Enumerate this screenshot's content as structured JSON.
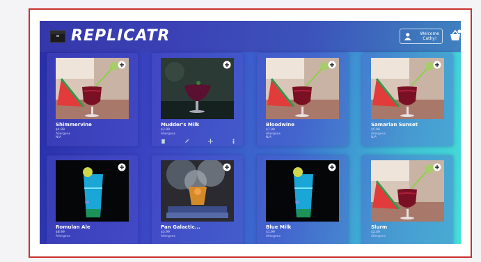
{
  "app": {
    "title": "REPLICATR",
    "welcome_label": "Welcome Cathy!"
  },
  "icons": {
    "logo": "chest-icon",
    "user": "user-icon",
    "cart": "basket-icon",
    "add": "plus-circle-icon"
  },
  "colors": {
    "frame_border": "#c8322e",
    "header": "#3c3ea8",
    "accent_cyan": "#45e0d8"
  },
  "products": [
    {
      "name": "Shimmervine",
      "price": "$4.99",
      "allergens": "Allergens",
      "note": "N/A",
      "image": "red-cocktail-watermelon"
    },
    {
      "name": "Mudder's Milk",
      "price": "$3.99",
      "allergens": "Allergens",
      "note": "",
      "image": "dark-cocktail",
      "actions": [
        "delete-icon",
        "edit-icon",
        "move-icon",
        "info-icon"
      ]
    },
    {
      "name": "Bloodwine",
      "price": "$7.99",
      "allergens": "Allergens",
      "note": "N/A",
      "image": "red-cocktail-watermelon"
    },
    {
      "name": "Samarian Sunset",
      "price": "$5.99",
      "allergens": "Allergens",
      "note": "N/A",
      "image": "red-cocktail-watermelon"
    },
    {
      "name": "Romulan Ale",
      "price": "$8.99",
      "allergens": "Allergens",
      "note": "",
      "image": "blue-cocktail"
    },
    {
      "name": "Pan Galactic...",
      "price": "$3.99",
      "allergens": "Allergens",
      "note": "",
      "image": "smoke-cocktail"
    },
    {
      "name": "Blue Milk",
      "price": "$1.99",
      "allergens": "Allergens",
      "note": "",
      "image": "blue-cocktail"
    },
    {
      "name": "Slurm",
      "price": "$2.49",
      "allergens": "Allergens",
      "note": "",
      "image": "red-cocktail-watermelon"
    }
  ]
}
